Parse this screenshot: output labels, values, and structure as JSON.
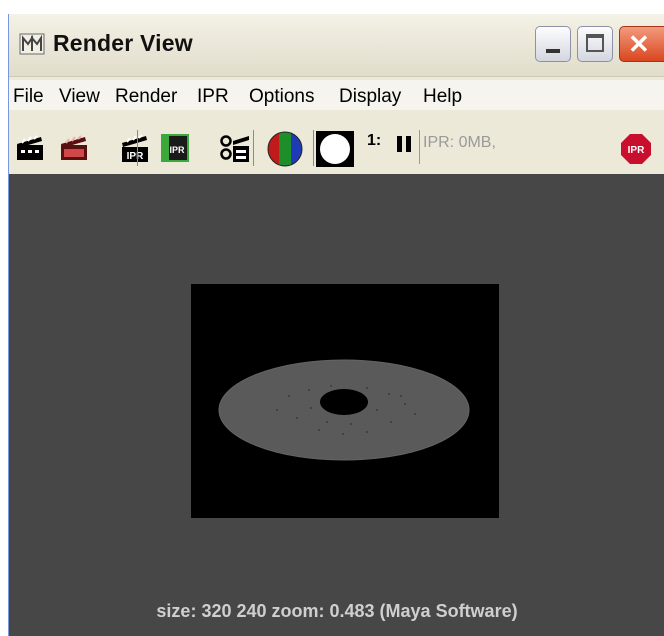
{
  "window": {
    "title": "Render View"
  },
  "menu": {
    "items": [
      "File",
      "View",
      "Render",
      "IPR",
      "Options",
      "Display",
      "Help"
    ]
  },
  "toolbar": {
    "buttons": [
      "render-icon",
      "rerender-region-icon",
      "ipr-render-icon",
      "ipr-refresh-icon",
      "snapshot-icon",
      "rgb-channels-icon",
      "alpha-channel-icon"
    ],
    "ratio_label": "1:",
    "ipr_memory_text": "IPR: 0MB,",
    "stop_ipr_label": "IPR"
  },
  "status": {
    "text": "size:  320  240 zoom: 0.483  (Maya Software)"
  },
  "colors": {
    "viewport_bg": "#474747",
    "render_bg": "#000000",
    "disc": "#5a5a5a",
    "stop_ipr": "#c8102e"
  }
}
